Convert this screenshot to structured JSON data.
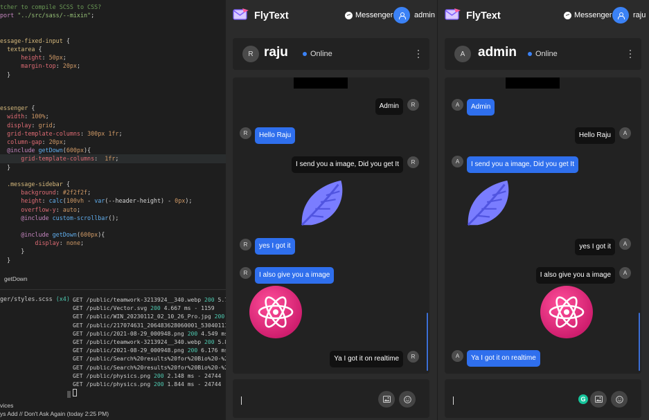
{
  "editor": {
    "code_lines": [
      [
        {
          "c": "cm",
          "t": "tcher to compile SCSS to CSS?"
        }
      ],
      [
        {
          "c": "kw",
          "t": "port "
        },
        {
          "c": "str",
          "t": "\"../src/sass/--mixin\""
        },
        {
          "c": "pl",
          "t": ";"
        }
      ],
      [],
      [],
      [
        {
          "c": "sel",
          "t": "essage-fixed-input "
        },
        {
          "c": "pl",
          "t": "{"
        }
      ],
      [
        {
          "c": "sel",
          "t": "  textarea "
        },
        {
          "c": "pl",
          "t": "{"
        }
      ],
      [
        {
          "c": "prop",
          "t": "      height"
        },
        {
          "c": "pl",
          "t": ": "
        },
        {
          "c": "val",
          "t": "50px"
        },
        {
          "c": "pl",
          "t": ";"
        }
      ],
      [
        {
          "c": "prop",
          "t": "      margin-top"
        },
        {
          "c": "pl",
          "t": ": "
        },
        {
          "c": "val",
          "t": "20px"
        },
        {
          "c": "pl",
          "t": ";"
        }
      ],
      [
        {
          "c": "pl",
          "t": "  }"
        }
      ],
      [],
      [],
      [],
      [
        {
          "c": "sel",
          "t": "essenger "
        },
        {
          "c": "pl",
          "t": "{"
        }
      ],
      [
        {
          "c": "prop",
          "t": "  width"
        },
        {
          "c": "pl",
          "t": ": "
        },
        {
          "c": "val",
          "t": "100%"
        },
        {
          "c": "pl",
          "t": ";"
        }
      ],
      [
        {
          "c": "prop",
          "t": "  display"
        },
        {
          "c": "pl",
          "t": ": "
        },
        {
          "c": "val",
          "t": "grid"
        },
        {
          "c": "pl",
          "t": ";"
        }
      ],
      [
        {
          "c": "prop",
          "t": "  grid-template-columns"
        },
        {
          "c": "pl",
          "t": ": "
        },
        {
          "c": "val",
          "t": "300px 1fr"
        },
        {
          "c": "pl",
          "t": ";"
        }
      ],
      [
        {
          "c": "prop",
          "t": "  column-gap"
        },
        {
          "c": "pl",
          "t": ": "
        },
        {
          "c": "val",
          "t": "20px"
        },
        {
          "c": "pl",
          "t": ";"
        }
      ],
      [
        {
          "c": "kw",
          "t": "  @include "
        },
        {
          "c": "fn",
          "t": "getDown"
        },
        {
          "c": "pl",
          "t": "("
        },
        {
          "c": "val",
          "t": "600px"
        },
        {
          "c": "pl",
          "t": "){"
        }
      ],
      [
        {
          "c": "prop",
          "t": "      grid-template-columns"
        },
        {
          "c": "pl",
          "t": ":  "
        },
        {
          "c": "val",
          "t": "1fr"
        },
        {
          "c": "pl",
          "t": ";"
        }
      ],
      [
        {
          "c": "pl",
          "t": "  }"
        }
      ],
      [],
      [
        {
          "c": "sel",
          "t": "  .message-sidebar "
        },
        {
          "c": "pl",
          "t": "{"
        }
      ],
      [
        {
          "c": "prop",
          "t": "      background"
        },
        {
          "c": "pl",
          "t": ": "
        },
        {
          "c": "val",
          "t": "#2f2f2f"
        },
        {
          "c": "pl",
          "t": ";"
        }
      ],
      [
        {
          "c": "prop",
          "t": "      height"
        },
        {
          "c": "pl",
          "t": ": "
        },
        {
          "c": "fn",
          "t": "calc"
        },
        {
          "c": "pl",
          "t": "("
        },
        {
          "c": "val",
          "t": "100vh"
        },
        {
          "c": "pl",
          "t": " - "
        },
        {
          "c": "fn",
          "t": "var"
        },
        {
          "c": "pl",
          "t": "(--header-height) - "
        },
        {
          "c": "val",
          "t": "0px"
        },
        {
          "c": "pl",
          "t": ");"
        }
      ],
      [
        {
          "c": "prop",
          "t": "      overflow-y"
        },
        {
          "c": "pl",
          "t": ": "
        },
        {
          "c": "val",
          "t": "auto"
        },
        {
          "c": "pl",
          "t": ";"
        }
      ],
      [
        {
          "c": "kw",
          "t": "      @include "
        },
        {
          "c": "fn",
          "t": "custom-scrollbar"
        },
        {
          "c": "pl",
          "t": "();"
        }
      ],
      [],
      [
        {
          "c": "kw",
          "t": "      @include "
        },
        {
          "c": "fn",
          "t": "getDown"
        },
        {
          "c": "pl",
          "t": "("
        },
        {
          "c": "val",
          "t": "600px"
        },
        {
          "c": "pl",
          "t": "){"
        }
      ],
      [
        {
          "c": "prop",
          "t": "          display"
        },
        {
          "c": "pl",
          "t": ": "
        },
        {
          "c": "val",
          "t": "none"
        },
        {
          "c": "pl",
          "t": ";"
        }
      ],
      [
        {
          "c": "pl",
          "t": "      }"
        }
      ],
      [
        {
          "c": "pl",
          "t": "  }"
        }
      ]
    ],
    "hint": "getDown",
    "terminal_left_file": "ger/styles.scss",
    "terminal_left_count": "(x4)",
    "terminal_lines": [
      {
        "pre": "GET /public/teamwork-3213924__340.webp ",
        "code": "200",
        "post": " 5.738 ms"
      },
      {
        "pre": "GET /public/Vector.svg ",
        "code": "200",
        "post": " 4.667 ms - 1159"
      },
      {
        "pre": "GET /public/WIN_20230112_02_10_26_Pro.jpg ",
        "code": "200",
        "post": " 5.299"
      },
      {
        "pre": "GET /public/217074631_206483628060001_5304011141723",
        "code": "",
        "post": ""
      },
      {
        "pre": "GET /public/2021-08-29_000948.png ",
        "code": "200",
        "post": " 4.549 ms - 873"
      },
      {
        "pre": "GET /public/teamwork-3213924__340.webp ",
        "code": "200",
        "post": " 5.856 ms"
      },
      {
        "pre": "GET /public/2021-08-29_000948.png ",
        "code": "200",
        "post": " 6.176 ms - 873"
      },
      {
        "pre": "GET /public/Search%20results%20for%20Bio%20-%20Flati",
        "code": "",
        "post": ""
      },
      {
        "pre": "GET /public/Search%20results%20for%20Bio%20-%20Flati",
        "code": "",
        "post": ""
      },
      {
        "pre": "GET /public/physics.png ",
        "code": "200",
        "post": " 2.148 ms - 24744"
      },
      {
        "pre": "GET /public/physics.png ",
        "code": "200",
        "post": " 1.844 ms - 24744"
      }
    ],
    "status_line1": "vices",
    "status_line2": "ys Add // Don't Ask Again (today 2:25 PM)"
  },
  "panels": [
    {
      "brand": "FlyText",
      "messenger_label": "Messenger",
      "user_label": "raju",
      "contact_initial": "R",
      "contact_name": "raju",
      "status": "Online",
      "messages": [
        {
          "side": "right",
          "type": "text",
          "text": "Admin",
          "initial": "R"
        },
        {
          "side": "left",
          "type": "text",
          "text": "Hello Raju",
          "initial": "R"
        },
        {
          "side": "right",
          "type": "text",
          "text": "I send you a image, Did you get It",
          "initial": "R"
        },
        {
          "side": "right",
          "type": "image",
          "image": "feather"
        },
        {
          "side": "left",
          "type": "text",
          "text": "yes I got it",
          "initial": "R"
        },
        {
          "side": "left",
          "type": "text",
          "text": "I also give you a image",
          "initial": "R"
        },
        {
          "side": "left",
          "type": "image",
          "image": "atom"
        },
        {
          "side": "right",
          "type": "text",
          "text": "Ya I got it on realtime",
          "initial": "R"
        }
      ],
      "input_placeholder": ""
    },
    {
      "brand": "FlyText",
      "messenger_label": "Messenger",
      "user_label": "raju",
      "contact_initial": "A",
      "contact_name": "admin",
      "status": "Online",
      "messages": [
        {
          "side": "left",
          "type": "text",
          "text": "Admin",
          "initial": "A"
        },
        {
          "side": "right",
          "type": "text",
          "text": "Hello Raju",
          "initial": "A"
        },
        {
          "side": "left",
          "type": "text",
          "text": "I send you a image, Did you get It",
          "initial": "A"
        },
        {
          "side": "left",
          "type": "image",
          "image": "feather"
        },
        {
          "side": "right",
          "type": "text",
          "text": "yes I got it",
          "initial": "A"
        },
        {
          "side": "right",
          "type": "text",
          "text": "I also give you a image",
          "initial": "A"
        },
        {
          "side": "right",
          "type": "image",
          "image": "atom"
        },
        {
          "side": "left",
          "type": "text",
          "text": "Ya I got it on realtime",
          "initial": "A"
        }
      ],
      "input_placeholder": ""
    }
  ],
  "panel_header_users": [
    "admin",
    "raju"
  ],
  "grammarly_letter": "G",
  "colors": {
    "accent": "#3b82f6",
    "bubble_blue": "#2f6fed",
    "bubble_dark": "#111111",
    "panel": "#2b2b2b",
    "card": "#222222"
  }
}
